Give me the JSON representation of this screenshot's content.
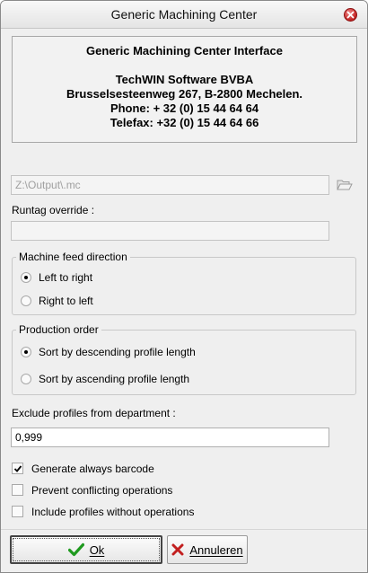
{
  "window": {
    "title": "Generic Machining Center"
  },
  "info": {
    "heading": "Generic Machining Center Interface",
    "company": "TechWIN Software BVBA",
    "address": "Brusselsesteenweg 267, B-2800 Mechelen.",
    "phone": "Phone: + 32 (0) 15 44 64 64",
    "fax": "Telefax: +32 (0) 15 44 64 66"
  },
  "output_path": {
    "value": "Z:\\Output\\.mc"
  },
  "runtag": {
    "label": "Runtag override :",
    "value": ""
  },
  "feed_direction": {
    "title": "Machine feed direction",
    "options": [
      {
        "label": "Left to right",
        "checked": true
      },
      {
        "label": "Right to left",
        "checked": false
      }
    ]
  },
  "production_order": {
    "title": "Production order",
    "options": [
      {
        "label": "Sort by descending profile length",
        "checked": true
      },
      {
        "label": "Sort by ascending profile length",
        "checked": false
      }
    ]
  },
  "exclude": {
    "label": "Exclude profiles from department :",
    "value": "0,999"
  },
  "checkboxes": [
    {
      "label": "Generate always barcode",
      "checked": true
    },
    {
      "label": "Prevent conflicting operations",
      "checked": false
    },
    {
      "label": "Include profiles without operations",
      "checked": false
    }
  ],
  "buttons": {
    "ok": "Ok",
    "cancel": "Annuleren"
  }
}
